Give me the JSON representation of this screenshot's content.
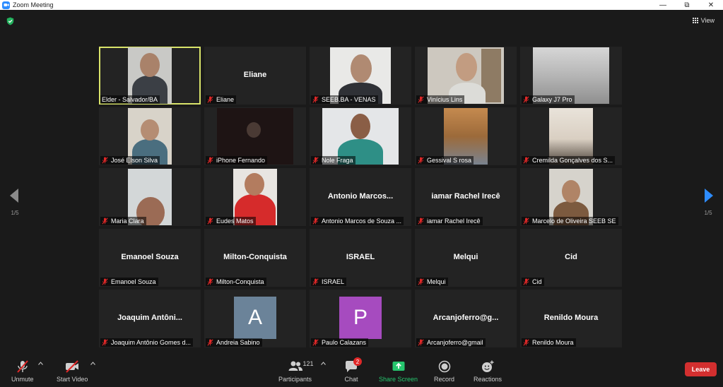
{
  "window": {
    "title": "Zoom Meeting",
    "minimize": "—",
    "maximize": "⧉",
    "close": "✕"
  },
  "header": {
    "view_label": "View"
  },
  "pagination": {
    "left": "1/5",
    "right": "1/5"
  },
  "participants": [
    {
      "label": "Elder - Salvador/BA",
      "muted": false,
      "active": true
    },
    {
      "label": "Eliane",
      "big_name": "Eliane",
      "muted": true
    },
    {
      "label": "SEEB.BA - VENAS",
      "muted": true
    },
    {
      "label": "Vinícius Lins",
      "muted": true
    },
    {
      "label": "Galaxy J7 Pro",
      "muted": true
    },
    {
      "label": "José Elson Silva",
      "muted": true
    },
    {
      "label": "iPhone Fernando",
      "muted": true
    },
    {
      "label": "Nole Fraga",
      "muted": true
    },
    {
      "label": "Gessival S rosa",
      "muted": true
    },
    {
      "label": "Cremilda Gonçalves dos S...",
      "muted": true
    },
    {
      "label": "Maria Clara",
      "muted": true
    },
    {
      "label": "Eudes Matos",
      "muted": true
    },
    {
      "label": "Antonio Marcos de Souza ...",
      "big_name": "Antonio  Marcos...",
      "muted": true
    },
    {
      "label": "iamar Rachel Irecê",
      "big_name": "iamar Rachel Irecê",
      "muted": true
    },
    {
      "label": "Marcelo de Oliveira SEEB SE",
      "muted": true
    },
    {
      "label": "Emanoel Souza",
      "big_name": "Emanoel Souza",
      "muted": true
    },
    {
      "label": "Milton-Conquista",
      "big_name": "Milton-Conquista",
      "muted": true
    },
    {
      "label": "ISRAEL",
      "big_name": "ISRAEL",
      "muted": true
    },
    {
      "label": "Melqui",
      "big_name": "Melqui",
      "muted": true
    },
    {
      "label": "Cid",
      "big_name": "Cid",
      "muted": true
    },
    {
      "label": "Joaquim Antônio Gomes d...",
      "big_name": "Joaquim  Antôni...",
      "muted": true
    },
    {
      "label": "Andreia Sabino",
      "avatar": "A",
      "avatar_color": "#6b8399",
      "muted": true
    },
    {
      "label": "Paulo Calazans",
      "avatar": "P",
      "avatar_color": "#a64bbf",
      "muted": true
    },
    {
      "label": "Arcanjoferro@gmail",
      "big_name": "Arcanjoferro@g...",
      "muted": true
    },
    {
      "label": "Renildo Moura",
      "big_name": "Renildo Moura",
      "muted": true
    }
  ],
  "toolbar": {
    "unmute": "Unmute",
    "start_video": "Start Video",
    "participants": "Participants",
    "participants_count": "121",
    "chat": "Chat",
    "chat_badge": "2",
    "share_screen": "Share Screen",
    "record": "Record",
    "reactions": "Reactions",
    "leave": "Leave"
  },
  "colors": {
    "active_border": "#d9e46a",
    "share_green": "#26c66e",
    "leave_red": "#d32f2f",
    "tile_bg": "#232323",
    "background": "#1a1a1a"
  },
  "icons": [
    "zoom-app-icon",
    "shield-icon",
    "grid-icon",
    "chevron-left-icon",
    "chevron-right-icon",
    "mic-muted-icon",
    "video-off-icon",
    "participants-icon",
    "chat-icon",
    "share-screen-icon",
    "record-icon",
    "reactions-icon"
  ]
}
